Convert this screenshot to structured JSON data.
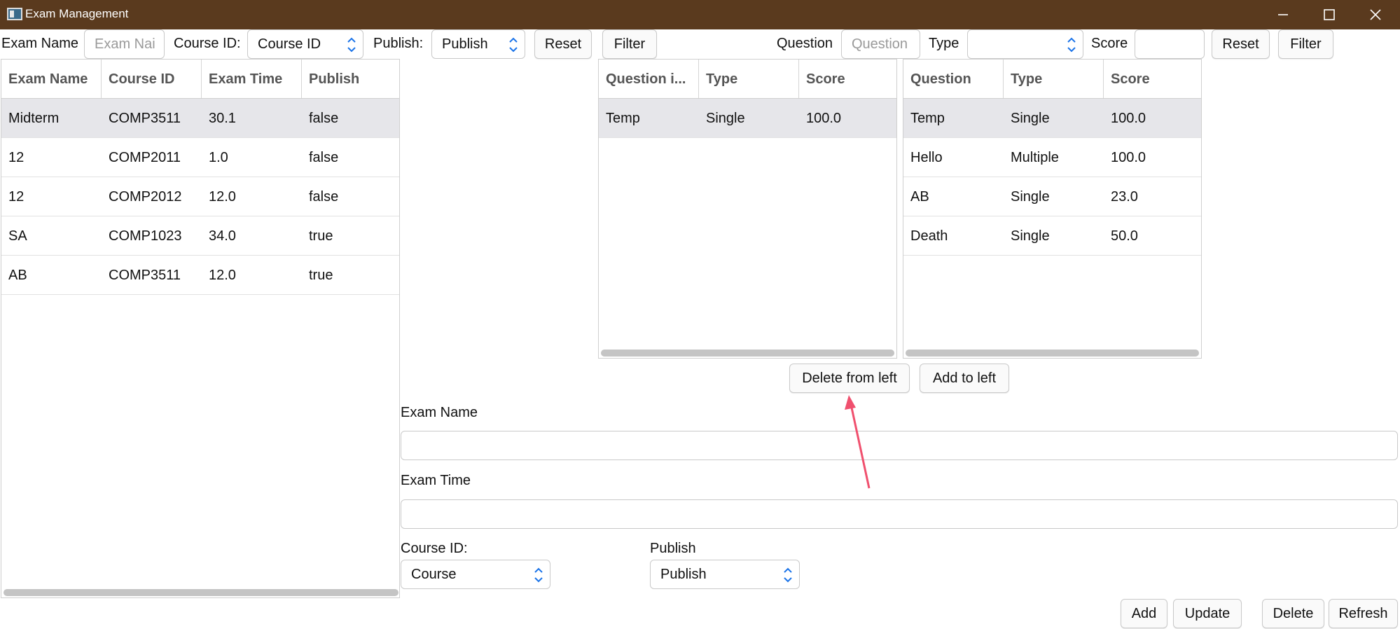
{
  "window": {
    "title": "Exam Management"
  },
  "filter_bar": {
    "exam_name_label": "Exam Name",
    "exam_name_placeholder": "Exam Nai",
    "course_id_label": "Course ID:",
    "course_id_value": "Course ID",
    "publish_label": "Publish:",
    "publish_value": "Publish",
    "reset_label": "Reset",
    "filter_label": "Filter",
    "question_label": "Question",
    "question_placeholder": "Question",
    "type_label": "Type",
    "type_value": "",
    "score_label": "Score",
    "score_value": "",
    "reset2_label": "Reset",
    "filter2_label": "Filter"
  },
  "exam_table": {
    "columns": [
      "Exam Name",
      "Course ID",
      "Exam Time",
      "Publish"
    ],
    "rows": [
      [
        "Midterm",
        "COMP3511",
        "30.1",
        "false"
      ],
      [
        "12",
        "COMP2011",
        "1.0",
        "false"
      ],
      [
        "12",
        "COMP2012",
        "12.0",
        "false"
      ],
      [
        "SA",
        "COMP1023",
        "34.0",
        "true"
      ],
      [
        "AB",
        "COMP3511",
        "12.0",
        "true"
      ]
    ]
  },
  "exam_questions_table": {
    "columns": [
      "Question i...",
      "Type",
      "Score"
    ],
    "rows": [
      [
        "Temp",
        "Single",
        "100.0"
      ]
    ]
  },
  "all_questions_table": {
    "columns": [
      "Question",
      "Type",
      "Score"
    ],
    "rows": [
      [
        "Temp",
        "Single",
        "100.0"
      ],
      [
        "Hello",
        "Multiple",
        "100.0"
      ],
      [
        "AB",
        "Single",
        "23.0"
      ],
      [
        "Death",
        "Single",
        "50.0"
      ]
    ]
  },
  "transfer": {
    "delete_from_left_label": "Delete from left",
    "add_to_left_label": "Add to left"
  },
  "form": {
    "exam_name_label": "Exam Name",
    "exam_name_value": "",
    "exam_time_label": "Exam Time",
    "exam_time_value": "",
    "course_id_label": "Course ID:",
    "course_id_value": "Course",
    "publish_label": "Publish",
    "publish_value": "Publish"
  },
  "actions": {
    "add_label": "Add",
    "update_label": "Update",
    "delete_label": "Delete",
    "refresh_label": "Refresh"
  },
  "colors": {
    "titlebar": "#5a3a1e",
    "selected_row": "#e6e6ea",
    "annotation_arrow": "#f0506e"
  },
  "icons": {
    "app": "app-window-icon",
    "minimize": "minimize-icon",
    "maximize": "maximize-icon",
    "close": "close-icon",
    "spinner": "spinner-updown-icon",
    "annotation": "annotation-arrow-icon"
  }
}
